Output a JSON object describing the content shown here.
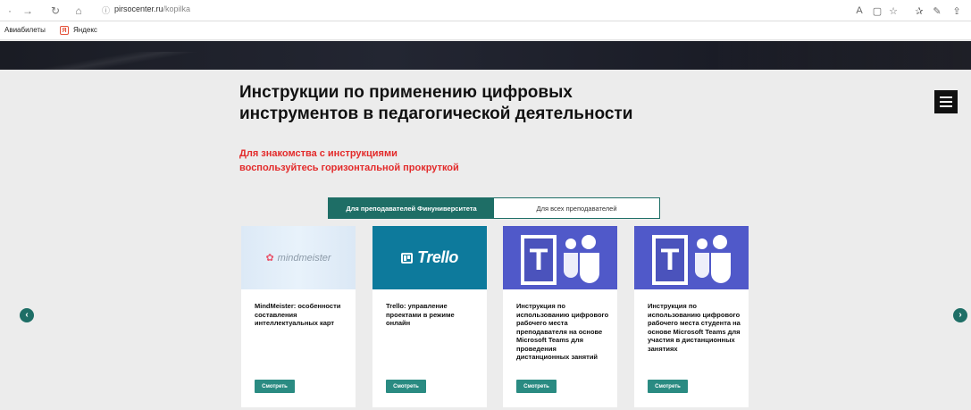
{
  "browser": {
    "url_host": "pirsocenter.ru",
    "url_path": "/kopilka",
    "icons": [
      "back-arrow-icon",
      "forward-arrow-icon",
      "refresh-icon",
      "home-icon",
      "site-info-icon",
      "read-aloud-icon",
      "reading-view-icon",
      "favorite-star-icon",
      "favorites-list-icon",
      "pen-icon",
      "share-icon"
    ]
  },
  "bookmarks": [
    {
      "label": "Авиабилеты"
    },
    {
      "label": "Яндекс"
    }
  ],
  "page": {
    "title_line1": "Инструкции по применению цифровых",
    "title_line2": "инструментов в педагогической деятельности",
    "subtitle_line1": "Для знакомства с инструкциями",
    "subtitle_line2": "воспользуйтесь горизонтальной прокруткой",
    "accent_color": "#e32b2b",
    "brand_color": "#1e6e66"
  },
  "tabs": [
    {
      "label": "Для преподавателей Финуниверситета",
      "active": true
    },
    {
      "label": "Для всех преподавателей",
      "active": false
    }
  ],
  "cards": [
    {
      "logo_text": "mindmeister",
      "text": "MindMeister: особенности составления интеллектуальных карт",
      "button": "Смотреть"
    },
    {
      "logo_text": "Trello",
      "text": "Trello: управление проектами в режиме онлайн",
      "button": "Смотреть"
    },
    {
      "logo_text": "T",
      "text": "Инструкция по использованию цифрового рабочего места преподавателя на основе Microsoft Teams для проведения дистанционных занятий",
      "button": "Смотреть"
    },
    {
      "logo_text": "T",
      "text": "Инструкция по использованию цифрового рабочего места студента на основе Microsoft Teams для участия в дистанционных занятиях",
      "button": "Смотреть"
    }
  ]
}
